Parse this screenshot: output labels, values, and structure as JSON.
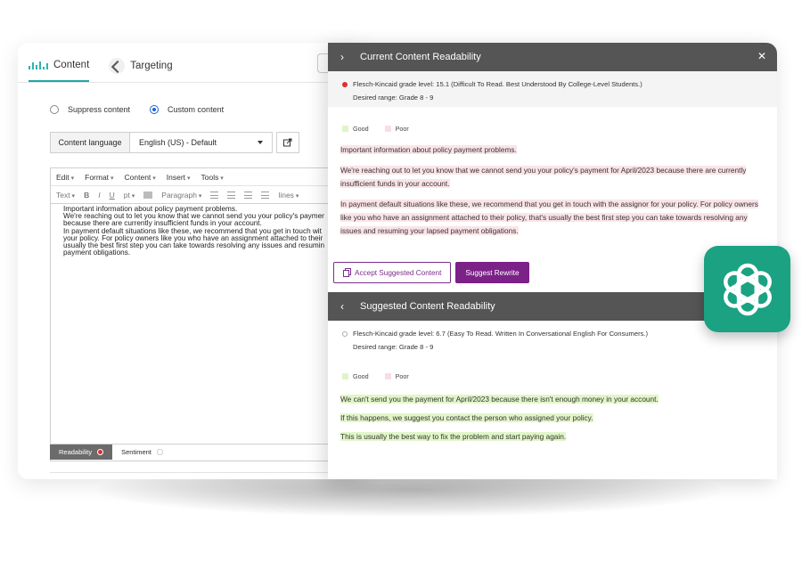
{
  "editor": {
    "tabs": [
      {
        "label": "Content",
        "active": true
      },
      {
        "label": "Targeting",
        "active": false
      }
    ],
    "radios": [
      {
        "label": "Suppress content",
        "selected": false
      },
      {
        "label": "Custom content",
        "selected": true
      }
    ],
    "language": {
      "label": "Content language",
      "value": "English (US) - Default"
    },
    "menus": [
      "Edit",
      "Format",
      "Content",
      "Insert",
      "Tools"
    ],
    "toolbar": {
      "text_dd": "Text",
      "bold": "B",
      "italic": "I",
      "underline": "U",
      "pt_dd": "pt",
      "paragraph_dd": "Paragraph",
      "lines_dd": "lines"
    },
    "document_lines": [
      "Important information about policy payment problems.",
      "We're reaching out to let you know that we cannot send you your policy's paymer",
      "because there are currently insufficient funds in your account.",
      "In payment default situations like these, we recommend that you get in touch wit",
      "your policy. For policy owners like you who have an assignment attached to their",
      "usually the best first step you can take towards resolving any issues and resumin",
      "payment obligations."
    ],
    "status": [
      {
        "label": "Readability",
        "active": true
      },
      {
        "label": "Sentiment",
        "active": false
      }
    ]
  },
  "panel": {
    "current": {
      "title": "Current Content Readability",
      "grade": "Flesch-Kincaid grade level: 15.1 (Difficult To Read. Best Understood By College-Level Students.)",
      "range": "Desired range: Grade 8 - 9",
      "legend_good": "Good",
      "legend_poor": "Poor",
      "paragraphs": [
        "Important information about policy payment problems.",
        "We're reaching out to let you know that we cannot send you your policy's payment for April/2023 because there are currently insufficient funds in your account.",
        "In payment default situations like these, we recommend that you get in touch with the assignor for your policy. For policy owners like you who have an assignment attached to their policy, that's usually the best first step you can take towards resolving any issues and resuming your lapsed payment obligations."
      ]
    },
    "buttons": {
      "accept": "Accept Suggested Content",
      "rewrite": "Suggest Rewrite"
    },
    "suggested": {
      "title": "Suggested Content Readability",
      "grade": "Flesch-Kincaid grade level: 6.7 (Easy To Read. Written In Conversational English For Consumers.)",
      "range": "Desired range: Grade 8 - 9",
      "legend_good": "Good",
      "legend_poor": "Poor",
      "paragraphs": [
        "We can't send you the payment for April/2023 because there isn't enough money in your account.",
        "If this happens, we suggest you contact the person who assigned your policy.",
        "This is usually the best way to fix the problem and start paying again."
      ]
    }
  },
  "colors": {
    "accent_purple": "#7b2188",
    "header_gray": "#555555",
    "good": "#e2f6c9",
    "poor": "#fbe4e8",
    "badge_green": "#1ba283",
    "tab_teal": "#1fa6a6"
  },
  "icons": [
    "chatgpt-logo-icon",
    "close-icon",
    "chevron-right-icon",
    "chevron-left-icon",
    "copy-icon",
    "external-link-icon"
  ]
}
